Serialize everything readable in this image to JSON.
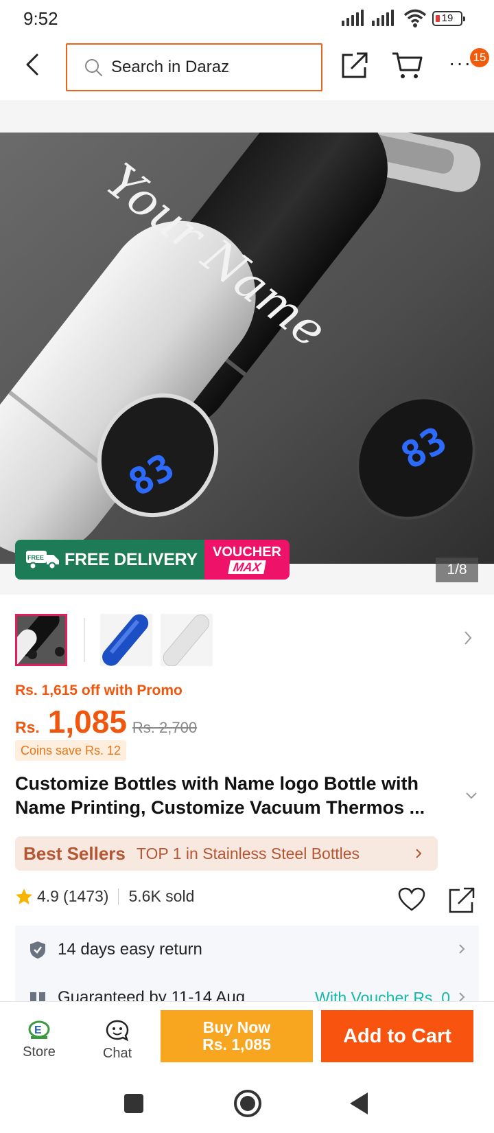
{
  "status_bar": {
    "time": "9:52",
    "battery": "19"
  },
  "header": {
    "search_placeholder": "Search in Daraz",
    "cart_badge": "15",
    "more": "···"
  },
  "gallery": {
    "image_text": "Your Name",
    "display_temp": "83",
    "delivery_label": "FREE DELIVERY",
    "delivery_small": "FREE",
    "voucher_line1": "VOUCHER",
    "voucher_line2": "MAX",
    "counter": "1/8",
    "thumbnail_count": 3
  },
  "price": {
    "promo": "Rs. 1,615 off with Promo",
    "currency": "Rs.",
    "amount": "1,085",
    "original": "Rs. 2,700",
    "coins": "Coins save Rs. 12"
  },
  "product": {
    "title": "Customize Bottles with Name logo Bottle with Name Printing, Customize Vacuum Thermos ..."
  },
  "best_sellers": {
    "tag": "Best Sellers",
    "text": "TOP 1 in Stainless Steel Bottles"
  },
  "rating": {
    "score": "4.9",
    "count": "(1473)",
    "sold": "5.6K sold"
  },
  "info": {
    "return": "14 days easy return",
    "delivery": "Guaranteed by 11-14 Aug",
    "voucher": "With Voucher Rs. 0"
  },
  "bottom_bar": {
    "store": "Store",
    "chat": "Chat",
    "buy_now_line1": "Buy Now",
    "buy_now_line2": "Rs. 1,085",
    "add_to_cart": "Add to Cart"
  },
  "colors": {
    "accent": "#f0560d",
    "buy_now": "#f8a51f",
    "add_to_cart": "#f8540f",
    "delivery_green": "#1e7b57",
    "voucher_pink": "#ee1269",
    "teal": "#14b8a6"
  }
}
